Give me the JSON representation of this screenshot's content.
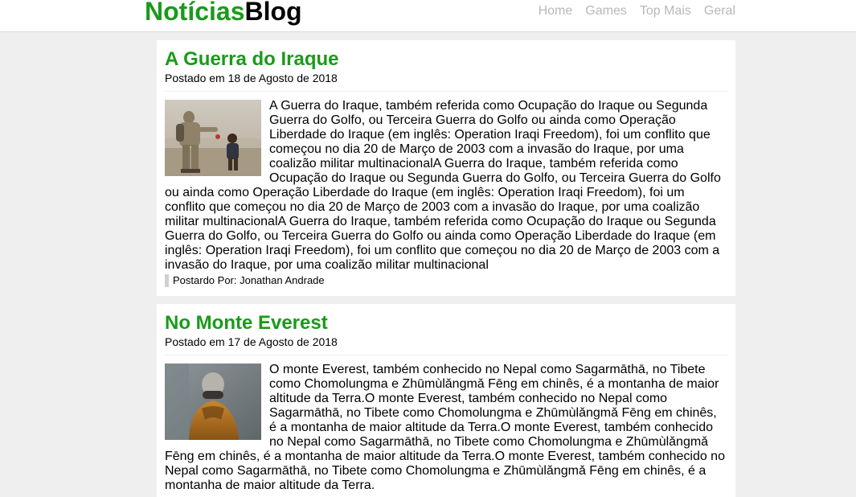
{
  "header": {
    "logo_part1": "Notícias",
    "logo_part2": "Blog",
    "nav": [
      "Home",
      "Games",
      "Top Mais",
      "Geral"
    ]
  },
  "posts": [
    {
      "title": "A Guerra do Iraque",
      "date": "Postado em 18 de Agosto de 2018",
      "body": "A Guerra do Iraque, também referida como Ocupação do Iraque ou Segunda Guerra do Golfo, ou Terceira Guerra do Golfo ou ainda como Operação Liberdade do Iraque (em inglês: Operation Iraqi Freedom), foi um conflito que começou no dia 20 de Março de 2003 com a invasão do Iraque, por uma coalizão militar multinacionalA Guerra do Iraque, também referida como Ocupação do Iraque ou Segunda Guerra do Golfo, ou Terceira Guerra do Golfo ou ainda como Operação Liberdade do Iraque (em inglês: Operation Iraqi Freedom), foi um conflito que começou no dia 20 de Março de 2003 com a invasão do Iraque, por uma coalizão militar multinacionalA Guerra do Iraque, também referida como Ocupação do Iraque ou Segunda Guerra do Golfo, ou Terceira Guerra do Golfo ou ainda como Operação Liberdade do Iraque (em inglês: Operation Iraqi Freedom), foi um conflito que começou no dia 20 de Março de 2003 com a invasão do Iraque, por uma coalizão militar multinacional",
      "author": "Postardo Por: Jonathan Andrade"
    },
    {
      "title": "No Monte Everest",
      "date": "Postado em 17 de Agosto de 2018",
      "body": "O monte Everest, também conhecido no Nepal como Sagarmāthā, no Tibete como Chomolungma e Zhūmùlǎngmǎ Fēng em chinês, é a montanha de maior altitude da Terra.O monte Everest, também conhecido no Nepal como Sagarmāthā, no Tibete como Chomolungma e Zhūmùlǎngmǎ Fēng em chinês, é a montanha de maior altitude da Terra.O monte Everest, também conhecido no Nepal como Sagarmāthā, no Tibete como Chomolungma e Zhūmùlǎngmǎ Fēng em chinês, é a montanha de maior altitude da Terra.O monte Everest, também conhecido no Nepal como Sagarmāthā, no Tibete como Chomolungma e Zhūmùlǎngmǎ Fēng em chinês, é a montanha de maior altitude da Terra."
    }
  ],
  "colors": {
    "brand_green": "#1a9a1a",
    "nav_link": "#b8b8b8",
    "page_bg": "#efefef"
  }
}
